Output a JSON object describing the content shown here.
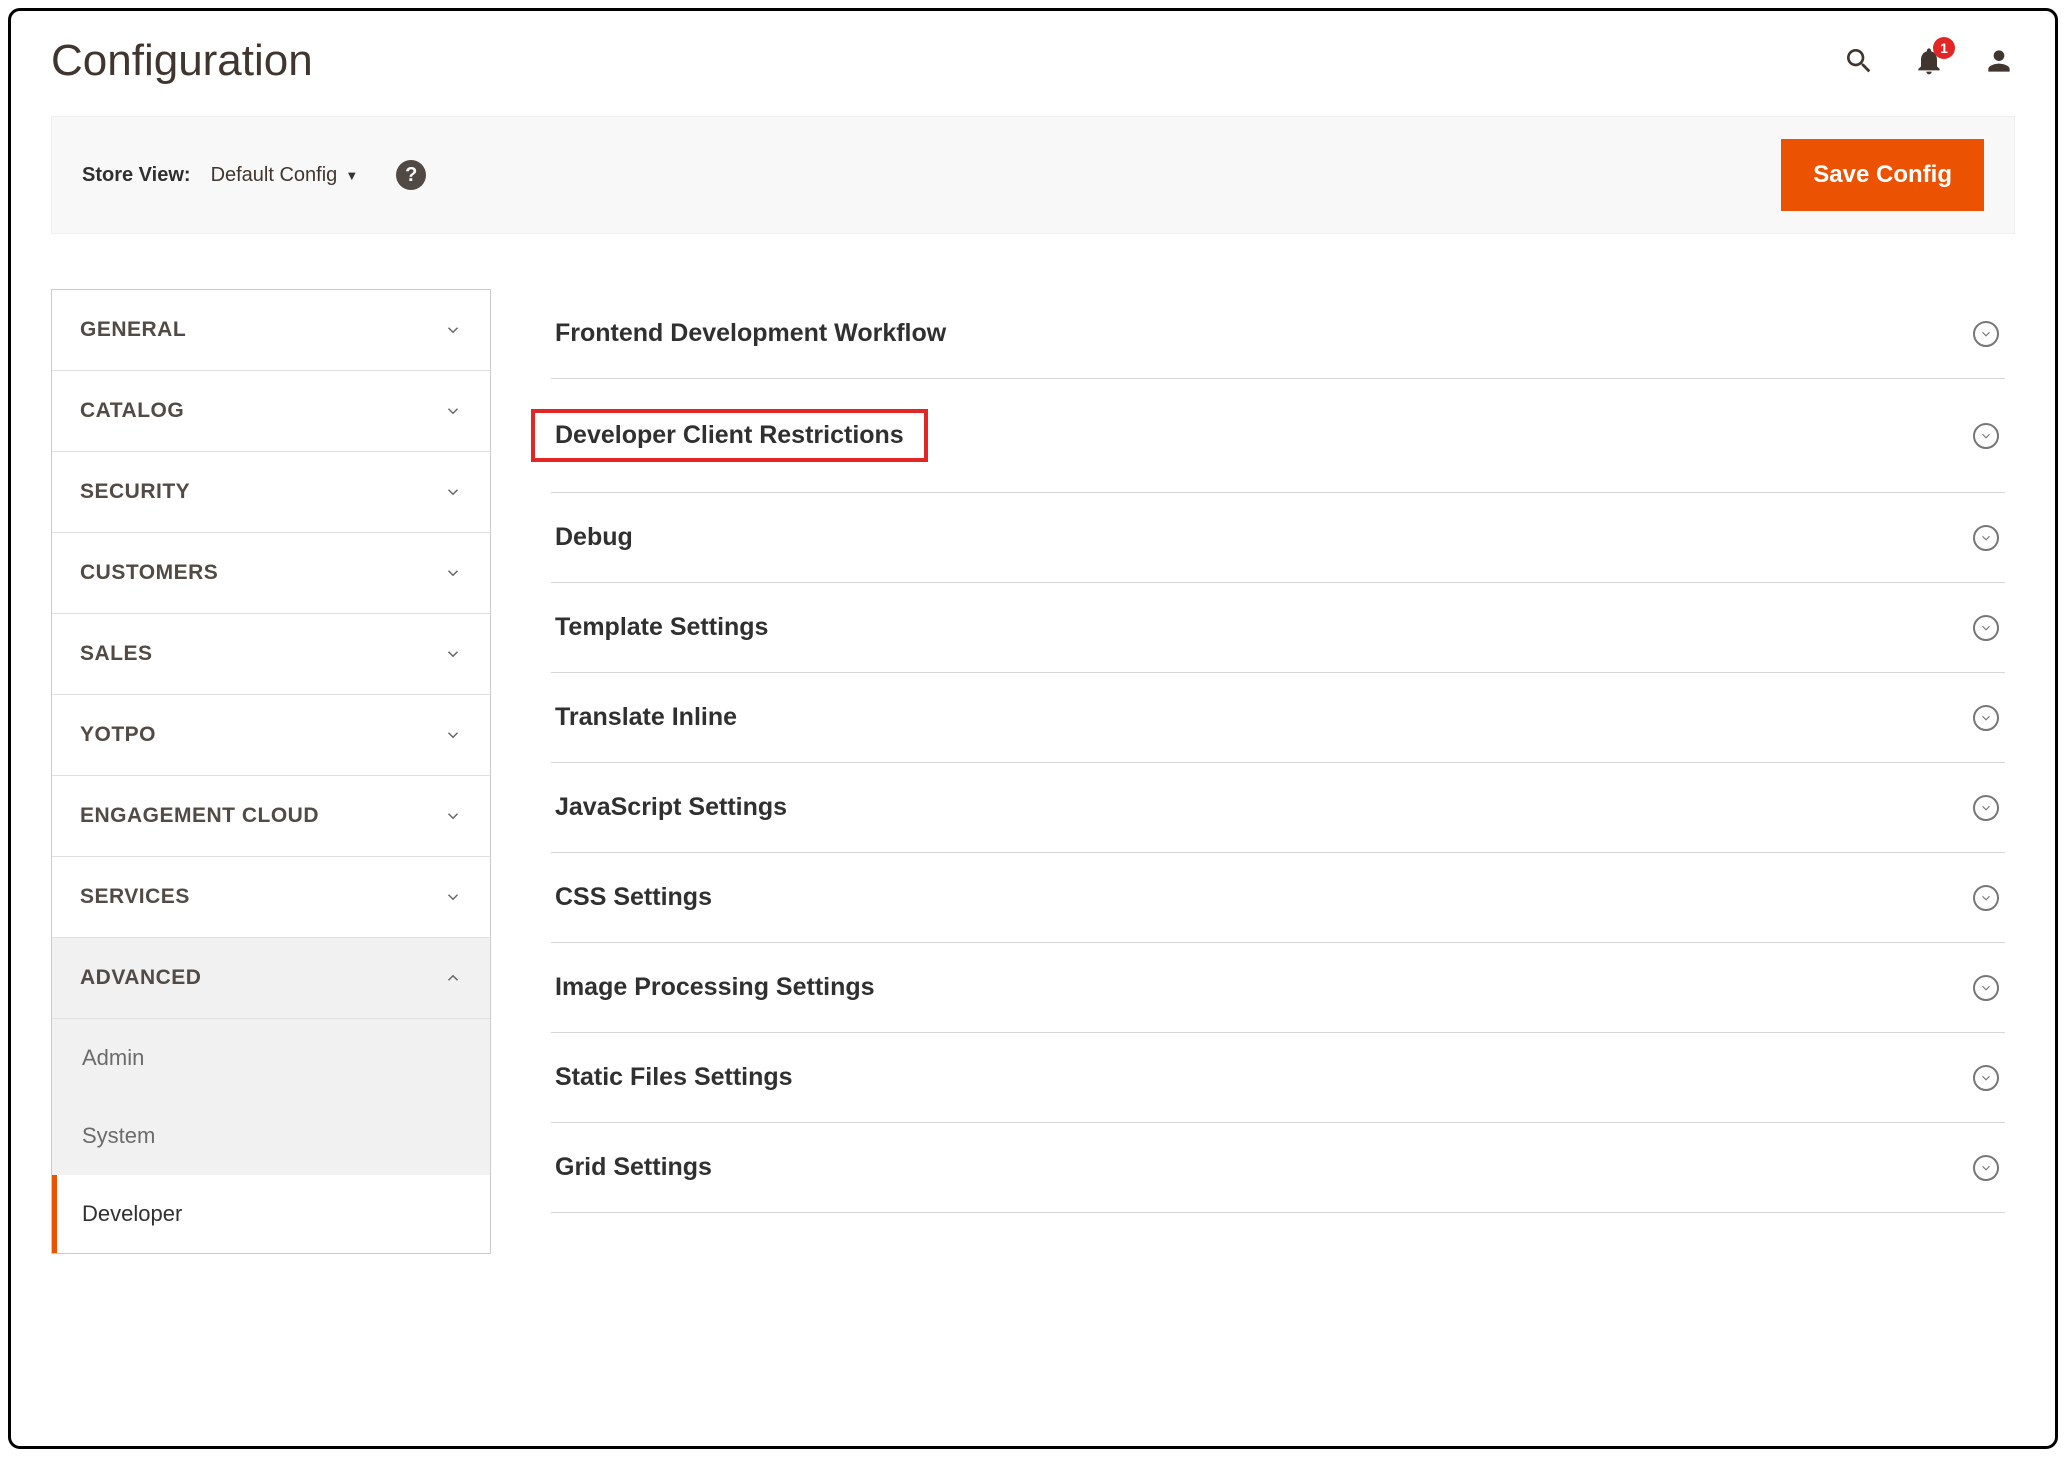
{
  "header": {
    "title": "Configuration",
    "notification_count": "1"
  },
  "toolbar": {
    "store_view_label": "Store View:",
    "store_view_value": "Default Config",
    "save_label": "Save Config"
  },
  "sidebar": {
    "groups": [
      {
        "label": "GENERAL",
        "expanded": false
      },
      {
        "label": "CATALOG",
        "expanded": false
      },
      {
        "label": "SECURITY",
        "expanded": false
      },
      {
        "label": "CUSTOMERS",
        "expanded": false
      },
      {
        "label": "SALES",
        "expanded": false
      },
      {
        "label": "YOTPO",
        "expanded": false
      },
      {
        "label": "ENGAGEMENT CLOUD",
        "expanded": false
      },
      {
        "label": "SERVICES",
        "expanded": false
      },
      {
        "label": "ADVANCED",
        "expanded": true
      }
    ],
    "advanced_items": [
      {
        "label": "Admin",
        "active": false
      },
      {
        "label": "System",
        "active": false
      },
      {
        "label": "Developer",
        "active": true
      }
    ]
  },
  "sections": [
    {
      "label": "Frontend Development Workflow",
      "highlighted": false
    },
    {
      "label": "Developer Client Restrictions",
      "highlighted": true
    },
    {
      "label": "Debug",
      "highlighted": false
    },
    {
      "label": "Template Settings",
      "highlighted": false
    },
    {
      "label": "Translate Inline",
      "highlighted": false
    },
    {
      "label": "JavaScript Settings",
      "highlighted": false
    },
    {
      "label": "CSS Settings",
      "highlighted": false
    },
    {
      "label": "Image Processing Settings",
      "highlighted": false
    },
    {
      "label": "Static Files Settings",
      "highlighted": false
    },
    {
      "label": "Grid Settings",
      "highlighted": false
    }
  ]
}
